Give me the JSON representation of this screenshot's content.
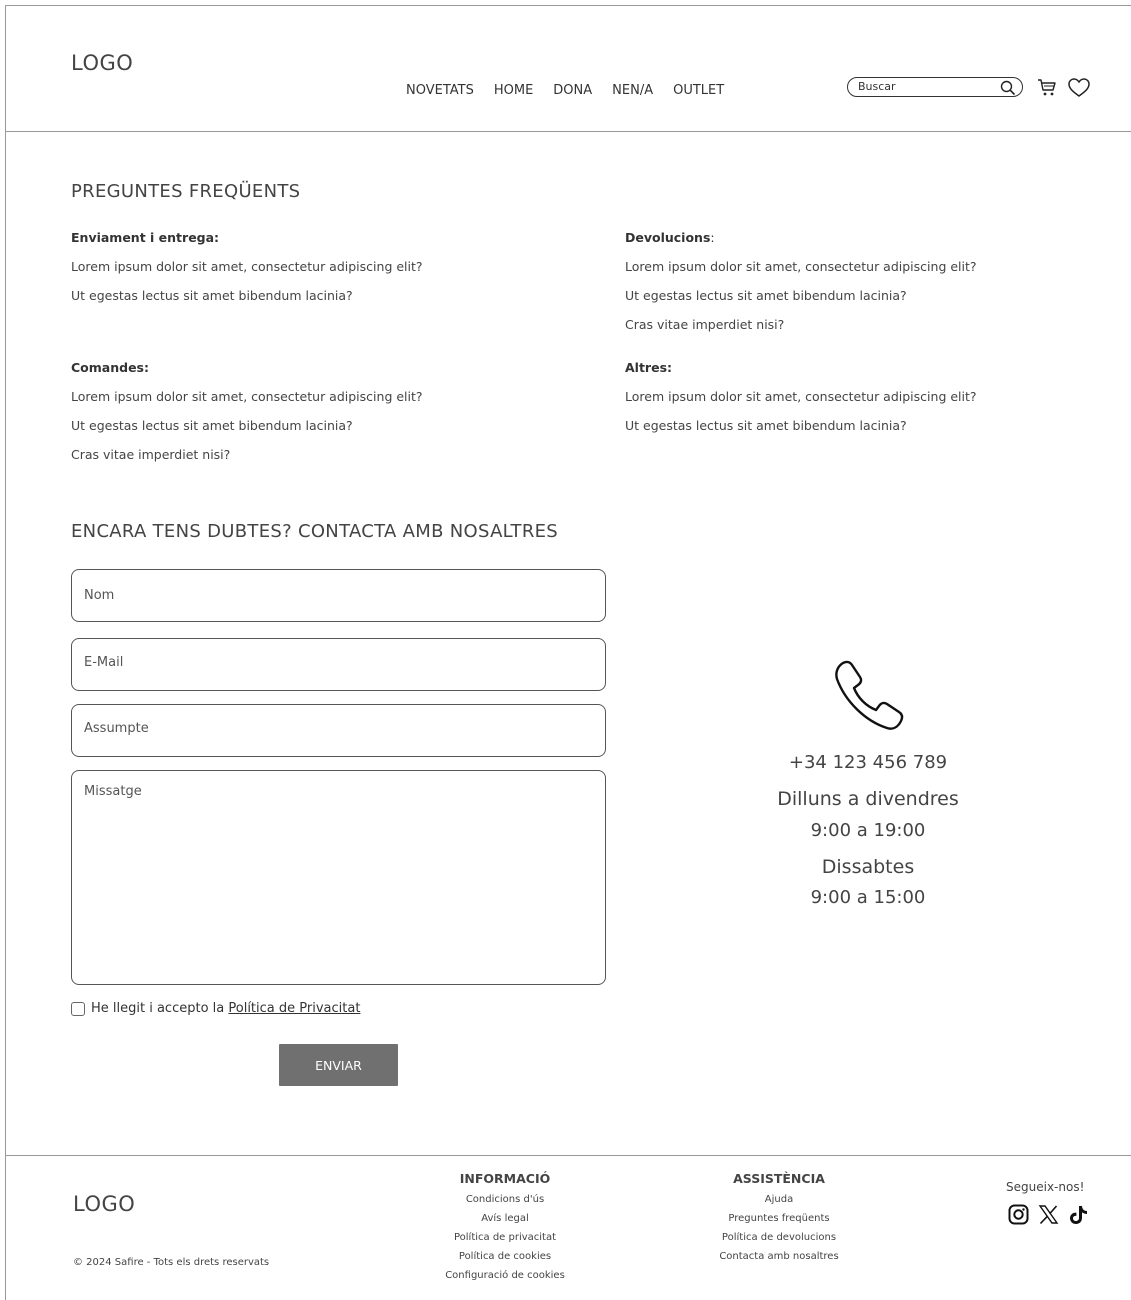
{
  "header": {
    "logo": "LOGO",
    "nav": [
      "NOVETATS",
      "HOME",
      "DONA",
      "NEN/A",
      "OUTLET"
    ],
    "search_placeholder": "Buscar",
    "icons": [
      "search-icon",
      "cart-icon",
      "heart-icon"
    ]
  },
  "faq": {
    "title": "PREGUNTES FREQÜENTS",
    "shipping": {
      "heading": "Enviament i entrega:",
      "items": [
        "Lorem ipsum dolor sit amet, consectetur adipiscing elit?",
        "Ut egestas lectus sit amet bibendum lacinia?"
      ]
    },
    "returns": {
      "heading": "Devolucions",
      "suffix": ":",
      "items": [
        "Lorem ipsum dolor sit amet, consectetur adipiscing elit?",
        "Ut egestas lectus sit amet bibendum lacinia?",
        "Cras vitae imperdiet nisi?"
      ]
    },
    "orders": {
      "heading": "Comandes:",
      "items": [
        "Lorem ipsum dolor sit amet, consectetur adipiscing elit?",
        "Ut egestas lectus sit amet bibendum lacinia?",
        "Cras vitae imperdiet nisi?"
      ]
    },
    "others": {
      "heading": "Altres:",
      "items": [
        "Lorem ipsum dolor sit amet, consectetur adipiscing elit?",
        "Ut egestas lectus sit amet bibendum lacinia?"
      ]
    }
  },
  "contact_form": {
    "title": "ENCARA TENS DUBTES? CONTACTA AMB NOSALTRES",
    "name_placeholder": "Nom",
    "email_placeholder": "E-Mail",
    "subject_placeholder": "Assumpte",
    "message_placeholder": "Missatge",
    "consent_prefix": "He llegit i accepto la ",
    "consent_link": "Política de Privacitat",
    "submit": "ENVIAR"
  },
  "contact_info": {
    "phone": "+34 123 456 789",
    "weekdays": "Dilluns a divendres",
    "weekdays_hours": "9:00 a 19:00",
    "saturday": "Dissabtes",
    "saturday_hours": "9:00 a 15:00"
  },
  "footer": {
    "logo": "LOGO",
    "copyright": "© 2024 Safire - Tots els drets reservats",
    "info": {
      "heading": "INFORMACIÓ",
      "links": [
        "Condicions d'ús",
        "Avís legal",
        "Política de privacitat",
        "Política de cookies",
        "Configuració de cookies"
      ]
    },
    "support": {
      "heading": "ASSISTÈNCIA",
      "links": [
        "Ajuda",
        "Preguntes freqüents",
        "Política de devolucions",
        "Contacta amb nosaltres"
      ]
    },
    "follow": "Segueix-nos!",
    "social_icons": [
      "instagram-icon",
      "x-icon",
      "tiktok-icon"
    ]
  }
}
